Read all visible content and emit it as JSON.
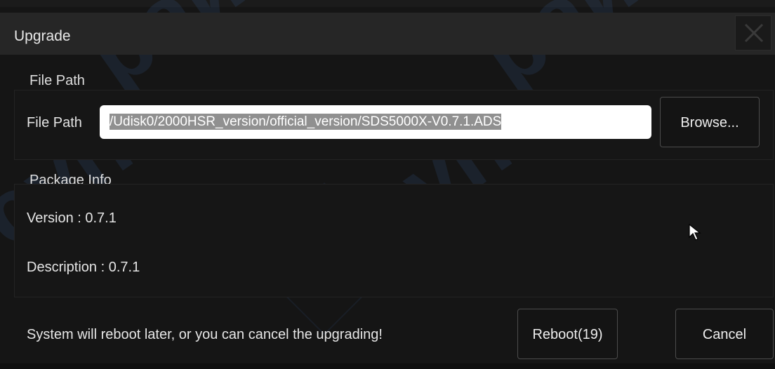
{
  "dialog": {
    "title": "Upgrade",
    "close_icon": "close-icon"
  },
  "file_path_group": {
    "legend": "File Path",
    "field_label": "File Path",
    "path_value": "/Udisk0/2000HSR_version/official_version/SDS5000X-V0.7.1.ADS",
    "browse_label": "Browse..."
  },
  "package_info_group": {
    "legend": "Package Info",
    "version_text": "Version : 0.7.1",
    "description_text": "Description : 0.7.1"
  },
  "footer": {
    "message": "System will reboot later, or you can cancel the upgrading!",
    "reboot_label": "Reboot(19)",
    "cancel_label": "Cancel"
  },
  "colors": {
    "background": "#151515",
    "titlebar": "#262626",
    "input_bg": "#ffffff",
    "selection": "#909090"
  }
}
